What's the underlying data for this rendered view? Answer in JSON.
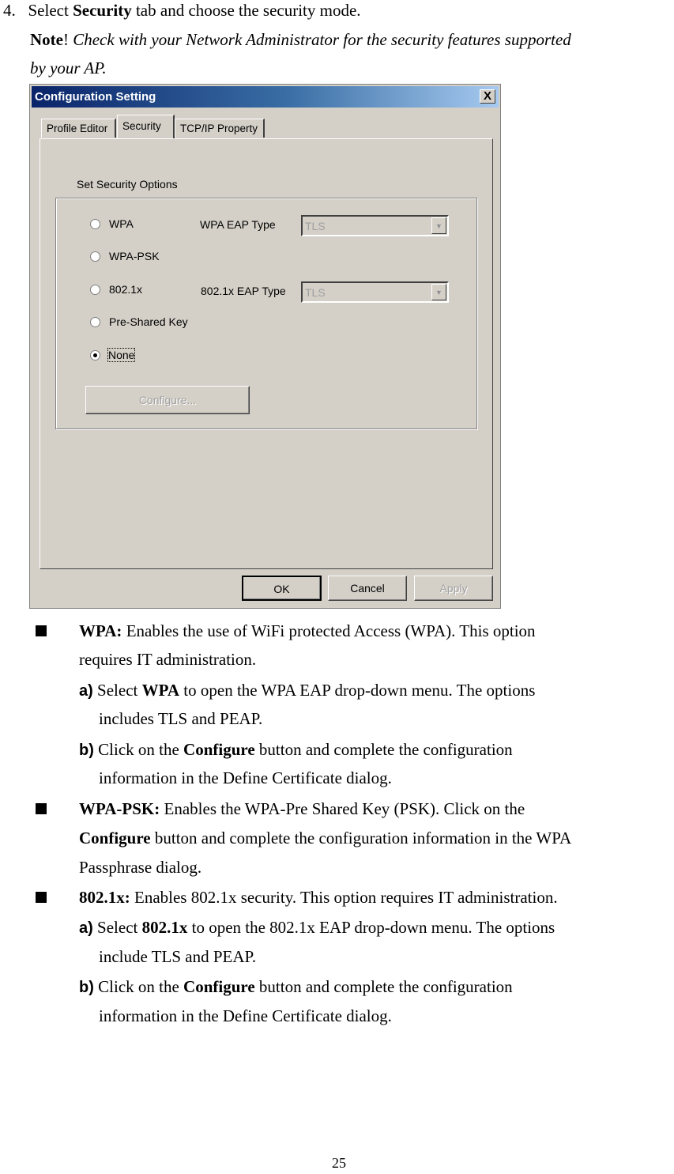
{
  "step": {
    "number": "4.",
    "text_before": "Select ",
    "bold": "Security",
    "text_after": " tab and choose the security mode."
  },
  "note": {
    "label": "Note",
    "excl": "!",
    "line1": "Check with your Network Administrator for the security features supported",
    "line2": "by your AP."
  },
  "dialog": {
    "title": "Configuration Setting",
    "close_label": "X",
    "tabs": [
      {
        "label": "Profile Editor",
        "active": false
      },
      {
        "label": "Security",
        "active": true
      },
      {
        "label": "TCP/IP Property",
        "active": false
      }
    ],
    "group_label": "Set Security Options",
    "options": [
      {
        "label": "WPA",
        "checked": false
      },
      {
        "label": "WPA-PSK",
        "checked": false
      },
      {
        "label": "802.1x",
        "checked": false
      },
      {
        "label": "Pre-Shared Key",
        "checked": false
      },
      {
        "label": "None",
        "checked": true
      }
    ],
    "wpa_eap_label": "WPA EAP Type",
    "wpa_eap_value": "TLS",
    "x8021_eap_label": "802.1x EAP Type",
    "x8021_eap_value": "TLS",
    "configure_label": "Configure...",
    "ok_label": "OK",
    "cancel_label": "Cancel",
    "apply_label": "Apply"
  },
  "bullets": {
    "wpa": {
      "term": "WPA:",
      "l1": " Enables the use of WiFi protected Access (WPA). This option",
      "l2": "requires IT administration.",
      "a_marker": "a)",
      "a_pre": " Select ",
      "a_bold": "WPA",
      "a_post": " to open the WPA EAP drop-down menu. The options",
      "a_l2": "includes TLS and PEAP.",
      "b_marker": "b)",
      "b_pre": " Click on the ",
      "b_bold": "Configure",
      "b_post": " button and complete the configuration",
      "b_l2": "information in the Define Certificate dialog."
    },
    "wpapsk": {
      "term": "WPA-PSK:",
      "l1": " Enables the WPA-Pre Shared Key (PSK). Click on the",
      "l2_bold": "Configure",
      "l2": " button and complete the configuration information in the WPA",
      "l3": "Passphrase dialog."
    },
    "x8021": {
      "term": "802.1x:",
      "l1": " Enables 802.1x security. This option requires IT administration.",
      "a_marker": "a)",
      "a_pre": " Select ",
      "a_bold": "802.1x",
      "a_post": " to open the 802.1x EAP drop-down menu. The options",
      "a_l2": "include TLS and PEAP.",
      "b_marker": "b)",
      "b_pre": " Click on the ",
      "b_bold": "Configure",
      "b_post": " button and complete the configuration",
      "b_l2": "information in the Define Certificate dialog."
    }
  },
  "page_number": "25"
}
